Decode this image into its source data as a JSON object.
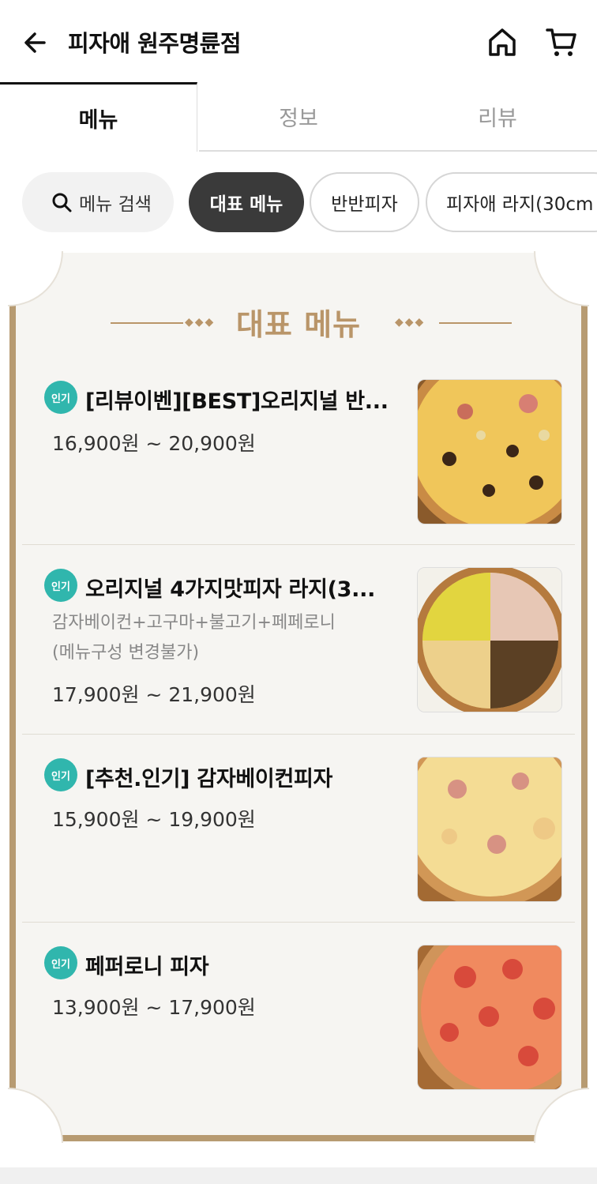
{
  "header": {
    "title": "피자애 원주명륜점",
    "back_icon": "back-arrow-icon",
    "home_icon": "home-icon",
    "cart_icon": "cart-icon"
  },
  "tabs": [
    {
      "label": "메뉴",
      "active": true
    },
    {
      "label": "정보",
      "active": false
    },
    {
      "label": "리뷰",
      "active": false
    }
  ],
  "chips": {
    "search_label": "메뉴 검색",
    "items": [
      "대표 메뉴",
      "반반피자",
      "피자애 라지(30cm"
    ],
    "selected": "대표 메뉴"
  },
  "section": {
    "title": "대표 메뉴",
    "accent_color": "#b99569"
  },
  "menu_items": [
    {
      "badge": "인기",
      "name": "[리뷰이벤][BEST]오리지널 반...",
      "description": "",
      "price": "16,900원 ~ 20,900원",
      "image": "pizza-bacon-bulgogi"
    },
    {
      "badge": "인기",
      "name": "오리지널 4가지맛피자 라지(3...",
      "description": "감자베이컨+고구마+불고기+페페로니\n(메뉴구성 변경불가)",
      "price": "17,900원 ~ 21,900원",
      "image": "pizza-four-flavor"
    },
    {
      "badge": "인기",
      "name": "[추천.인기] 감자베이컨피자",
      "description": "",
      "price": "15,900원 ~ 19,900원",
      "image": "pizza-potato-bacon"
    },
    {
      "badge": "인기",
      "name": "페퍼로니 피자",
      "description": "",
      "price": "13,900원 ~ 17,900원",
      "image": "pizza-pepperoni"
    }
  ],
  "colors": {
    "badge": "#30b6ad",
    "selected_chip": "#3a3a3a",
    "board_frame": "#b79b72"
  }
}
